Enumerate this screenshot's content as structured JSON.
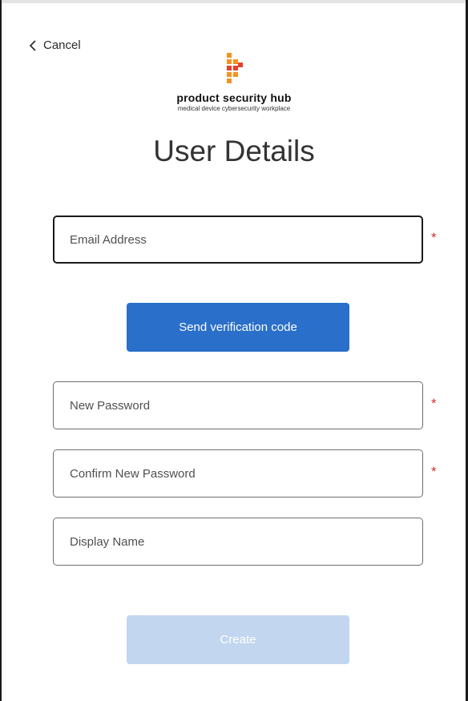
{
  "nav": {
    "cancel_label": "Cancel"
  },
  "brand": {
    "name": "product security hub",
    "tagline": "medical device cybersecurity workplace",
    "colors": {
      "orange": "#f39221",
      "red": "#e4412b"
    }
  },
  "page": {
    "title": "User Details"
  },
  "form": {
    "email": {
      "placeholder": "Email Address",
      "value": "",
      "required": "*"
    },
    "send_code_label": "Send verification code",
    "new_password": {
      "placeholder": "New Password",
      "value": "",
      "required": "*"
    },
    "confirm_password": {
      "placeholder": "Confirm New Password",
      "value": "",
      "required": "*"
    },
    "display_name": {
      "placeholder": "Display Name",
      "value": ""
    },
    "create_label": "Create"
  },
  "colors": {
    "primary": "#2a6fc9",
    "primary_disabled": "#c2d6ef",
    "required": "#d03030"
  }
}
